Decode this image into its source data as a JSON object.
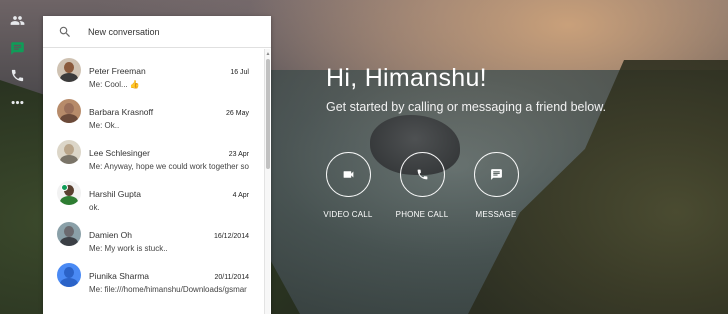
{
  "rail": {
    "items": [
      {
        "icon": "contacts-icon"
      },
      {
        "icon": "chat-icon",
        "active": true,
        "color": "#0f9d58"
      },
      {
        "icon": "phone-icon"
      },
      {
        "icon": "more-icon"
      }
    ]
  },
  "search": {
    "placeholder": "New conversation"
  },
  "conversations": [
    {
      "name": "Peter Freeman",
      "date": "16 Jul",
      "snippet": "Me: Cool... ",
      "emoji": "👍",
      "avatar_color": "#8a5a3c"
    },
    {
      "name": "Barbara Krasnoff",
      "date": "26 May",
      "snippet": "Me: Ok..",
      "avatar_color": "#9a6f5a"
    },
    {
      "name": "Lee Schlesinger",
      "date": "23 Apr",
      "snippet": "Me: Anyway, hope we could work together so",
      "avatar_color": "#b9a58a"
    },
    {
      "name": "Harshil Gupta",
      "date": "4 Apr",
      "snippet": "ok.",
      "avatar_color": "#5a4030",
      "online": true
    },
    {
      "name": "Damien Oh",
      "date": "16/12/2014",
      "snippet": "Me: My work is stuck..",
      "avatar_color": "#6b6a6f"
    },
    {
      "name": "Piunika Sharma",
      "date": "20/11/2014",
      "snippet": "Me: file:///home/himanshu/Downloads/gsmar",
      "avatar_color": "#4a8af4"
    }
  ],
  "greeting": {
    "title": "Hi, Himanshu!",
    "subtitle": "Get started by calling or messaging a friend below."
  },
  "actions": [
    {
      "label": "VIDEO CALL",
      "icon": "video-icon"
    },
    {
      "label": "PHONE CALL",
      "icon": "phone-icon"
    },
    {
      "label": "MESSAGE",
      "icon": "message-icon"
    }
  ],
  "colors": {
    "accent_green": "#0f9d58",
    "panel_bg": "#ffffff"
  }
}
